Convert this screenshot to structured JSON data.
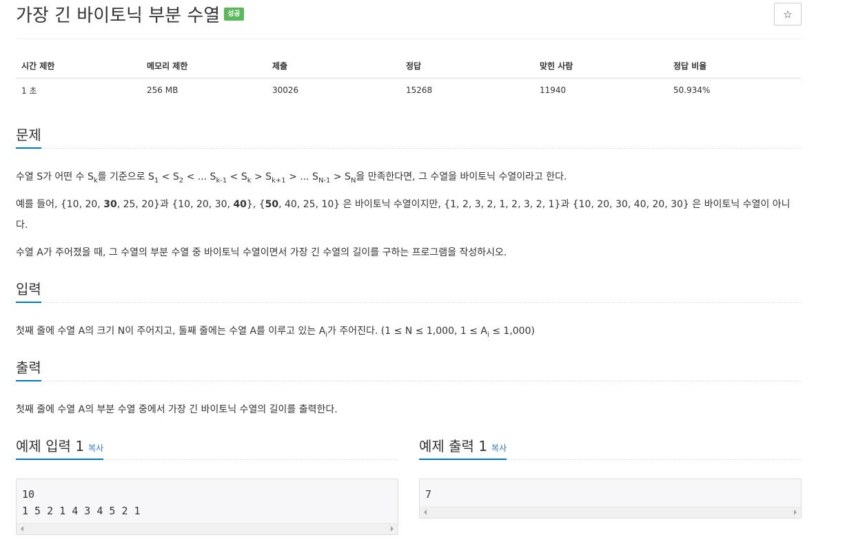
{
  "problem": {
    "title": "가장 긴 바이토닉 부분 수열",
    "badge": "성공",
    "star": "☆"
  },
  "info_table": {
    "headers": [
      "시간 제한",
      "메모리 제한",
      "제출",
      "정답",
      "맞힌 사람",
      "정답 비율"
    ],
    "values": [
      "1 초",
      "256 MB",
      "30026",
      "15268",
      "11940",
      "50.934%"
    ]
  },
  "sections": {
    "description": "문제",
    "input": "입력",
    "output": "출력",
    "sample_input": "예제 입력 1",
    "sample_output": "예제 출력 1",
    "copy": "복사"
  },
  "description": {
    "p1": {
      "a": "수열 S가 어떤 수 S",
      "sk": "k",
      "b": "를 기준으로 S",
      "s1": "1",
      "c": " < S",
      "s2": "2",
      "d": " < ... S",
      "skm1": "k-1",
      "e": " < S",
      "sk2": "k",
      "f": " > S",
      "skp1": "k+1",
      "g": " > ... S",
      "snm1": "N-1",
      "h": " > S",
      "sn": "N",
      "i": "을 만족한다면, 그 수열을 바이토닉 수열이라고 한다."
    },
    "p2": {
      "a": "예를 들어, {10, 20, ",
      "b1": "30",
      "c": ", 25, 20}과 {10, 20, 30, ",
      "b2": "40",
      "d": "}, {",
      "b3": "50",
      "e": ", 40, 25, 10} 은 바이토닉 수열이지만,  {1, 2, 3, 2, 1, 2, 3, 2, 1}과 {10, 20, 30, 40, 20, 30} 은 바이토닉 수열이 아니다."
    },
    "p3": "수열 A가 주어졌을 때, 그 수열의 부분 수열 중 바이토닉 수열이면서 가장 긴 수열의 길이를 구하는 프로그램을 작성하시오."
  },
  "input_text": {
    "a": "첫째 줄에 수열 A의 크기 N이 주어지고, 둘째 줄에는 수열 A를 이루고 있는 A",
    "sub": "i",
    "b": "가 주어진다. (1 ≤ N ≤ 1,000, 1 ≤ A",
    "sub2": "i",
    "c": " ≤ 1,000)"
  },
  "output_text": "첫째 줄에 수열 A의 부분 수열 중에서 가장 긴 바이토닉 수열의 길이를 출력한다.",
  "samples": {
    "input": "10\n1 5 2 1 4 3 4 5 2 1",
    "output": "7"
  }
}
